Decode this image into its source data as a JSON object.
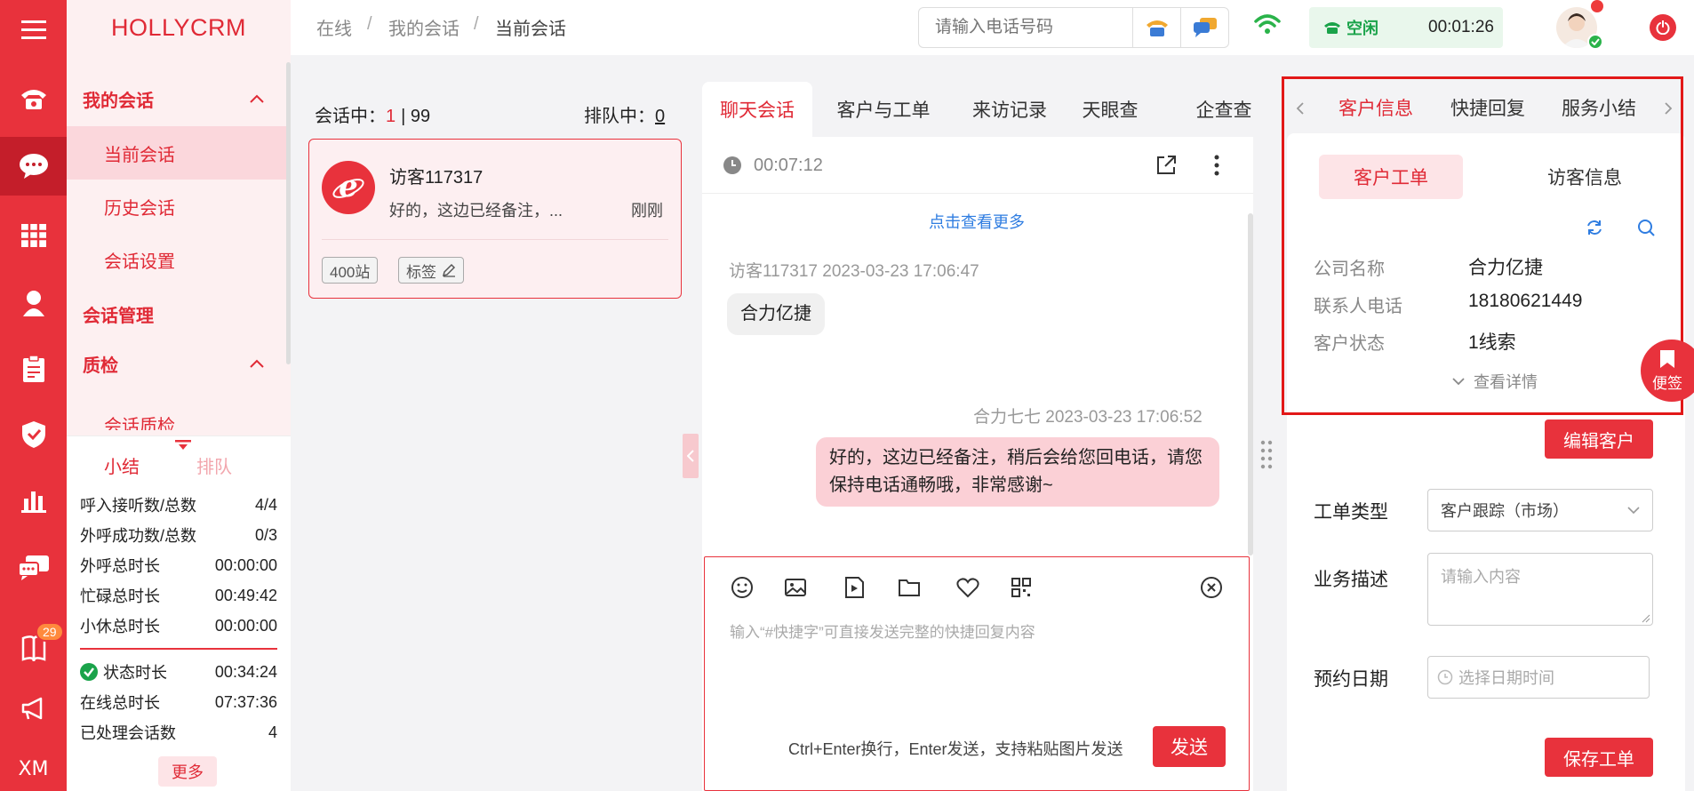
{
  "app": {
    "logo": "HOLLYCRM"
  },
  "rail": {
    "badge_count": "29",
    "bottom_label": "XM"
  },
  "nav": {
    "group_my_sessions": "我的会话",
    "item_current": "当前会话",
    "item_history": "历史会话",
    "item_settings": "会话设置",
    "group_management": "会话管理",
    "group_quality": "质检",
    "item_quality_partial": "会话质检"
  },
  "stats": {
    "tab_summary": "小结",
    "tab_queue": "排队",
    "rows_top": [
      {
        "label": "呼入接听数/总数",
        "value": "4/4"
      },
      {
        "label": "外呼成功数/总数",
        "value": "0/3"
      },
      {
        "label": "外呼总时长",
        "value": "00:00:00"
      },
      {
        "label": "忙碌总时长",
        "value": "00:49:42"
      },
      {
        "label": "小休总时长",
        "value": "00:00:00"
      }
    ],
    "rows_bottom": [
      {
        "label": "状态时长",
        "value": "00:34:24"
      },
      {
        "label": "在线总时长",
        "value": "07:37:36"
      },
      {
        "label": "已处理会话数",
        "value": "4"
      }
    ],
    "more": "更多"
  },
  "header": {
    "breadcrumb": [
      "在线",
      "我的会话",
      "当前会话"
    ],
    "separator": "/",
    "phone_placeholder": "请输入电话号码",
    "status_label": "空闲",
    "status_timer": "00:01:26"
  },
  "sessions": {
    "in_session_label": "会话中：",
    "in_session_count": "1",
    "in_session_total": "| 99",
    "queue_label": "排队中：",
    "queue_count": "0",
    "card": {
      "name": "访客117317",
      "preview": "好的，这边已经备注，...",
      "time": "刚刚",
      "tag1": "400站",
      "tag2": "标签"
    }
  },
  "chat": {
    "tabs": [
      "聊天会话",
      "客户与工单",
      "来访记录",
      "天眼查",
      "企查查"
    ],
    "timer": "00:07:12",
    "load_more": "点击查看更多",
    "msg1_meta": "访客117317 2023-03-23 17:06:47",
    "msg1_text": "合力亿捷",
    "msg2_meta": "合力七七 2023-03-23 17:06:52",
    "msg2_text": "好的，这边已经备注，稍后会给您回电话，请您保持电话通畅哦，非常感谢~",
    "input_placeholder": "输入“#快捷字”可直接发送完整的快捷回复内容",
    "hint": "Ctrl+Enter换行，Enter发送，支持粘贴图片发送",
    "send": "发送"
  },
  "right": {
    "tabs": [
      "客户信息",
      "快捷回复",
      "服务小结"
    ],
    "sub_tab_ticket": "客户工单",
    "sub_tab_visitor": "访客信息",
    "fields": [
      {
        "label": "公司名称",
        "value": "合力亿捷"
      },
      {
        "label": "联系人电话",
        "value": "18180621449"
      },
      {
        "label": "客户状态",
        "value": "1线索"
      }
    ],
    "view_details": "查看详情",
    "edit_customer": "编辑客户",
    "ticket_type_label": "工单类型",
    "ticket_type_value": "客户跟踪（市场）",
    "desc_label": "业务描述",
    "desc_placeholder": "请输入内容",
    "date_label": "预约日期",
    "date_placeholder": "选择日期时间",
    "save_ticket": "保存工单",
    "fab_label": "便签"
  },
  "colors": {
    "brand": "#e8323c",
    "brand_dark": "#c41e2a",
    "highlight": "#e21818",
    "status_green": "#1aa34a"
  }
}
